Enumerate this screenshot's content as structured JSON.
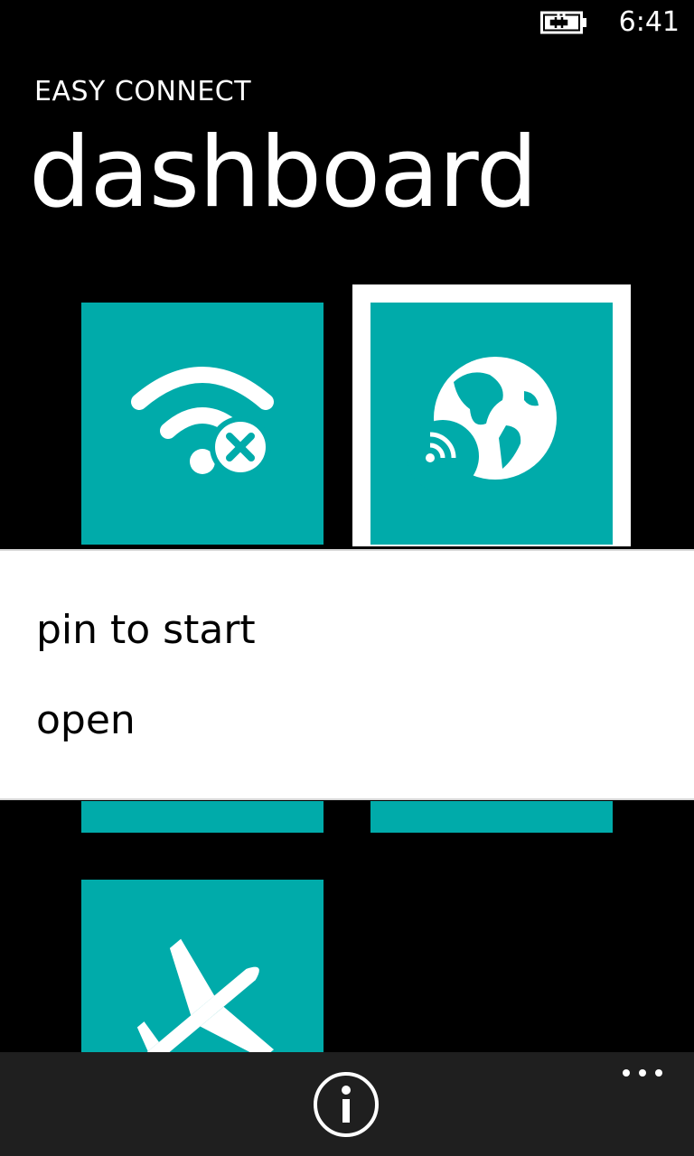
{
  "status_bar": {
    "time": "6:41",
    "battery_icon": "battery-charging-icon"
  },
  "header": {
    "app_title": "EASY CONNECT",
    "page_title": "dashboard"
  },
  "tiles": [
    {
      "icon": "wifi-disconnected-icon",
      "selected": false
    },
    {
      "icon": "globe-wireless-icon",
      "selected": true
    },
    {
      "icon": "airplane-icon",
      "selected": false
    }
  ],
  "context_menu": {
    "items": [
      {
        "label": "pin to start"
      },
      {
        "label": "open"
      }
    ]
  },
  "app_bar": {
    "buttons": [
      {
        "icon": "info-icon"
      },
      {
        "icon": "more-ellipsis-icon"
      }
    ]
  },
  "colors": {
    "accent": "#00abaa",
    "background": "#000000",
    "menu_background": "#ffffff",
    "app_bar": "#1f1f1f"
  }
}
